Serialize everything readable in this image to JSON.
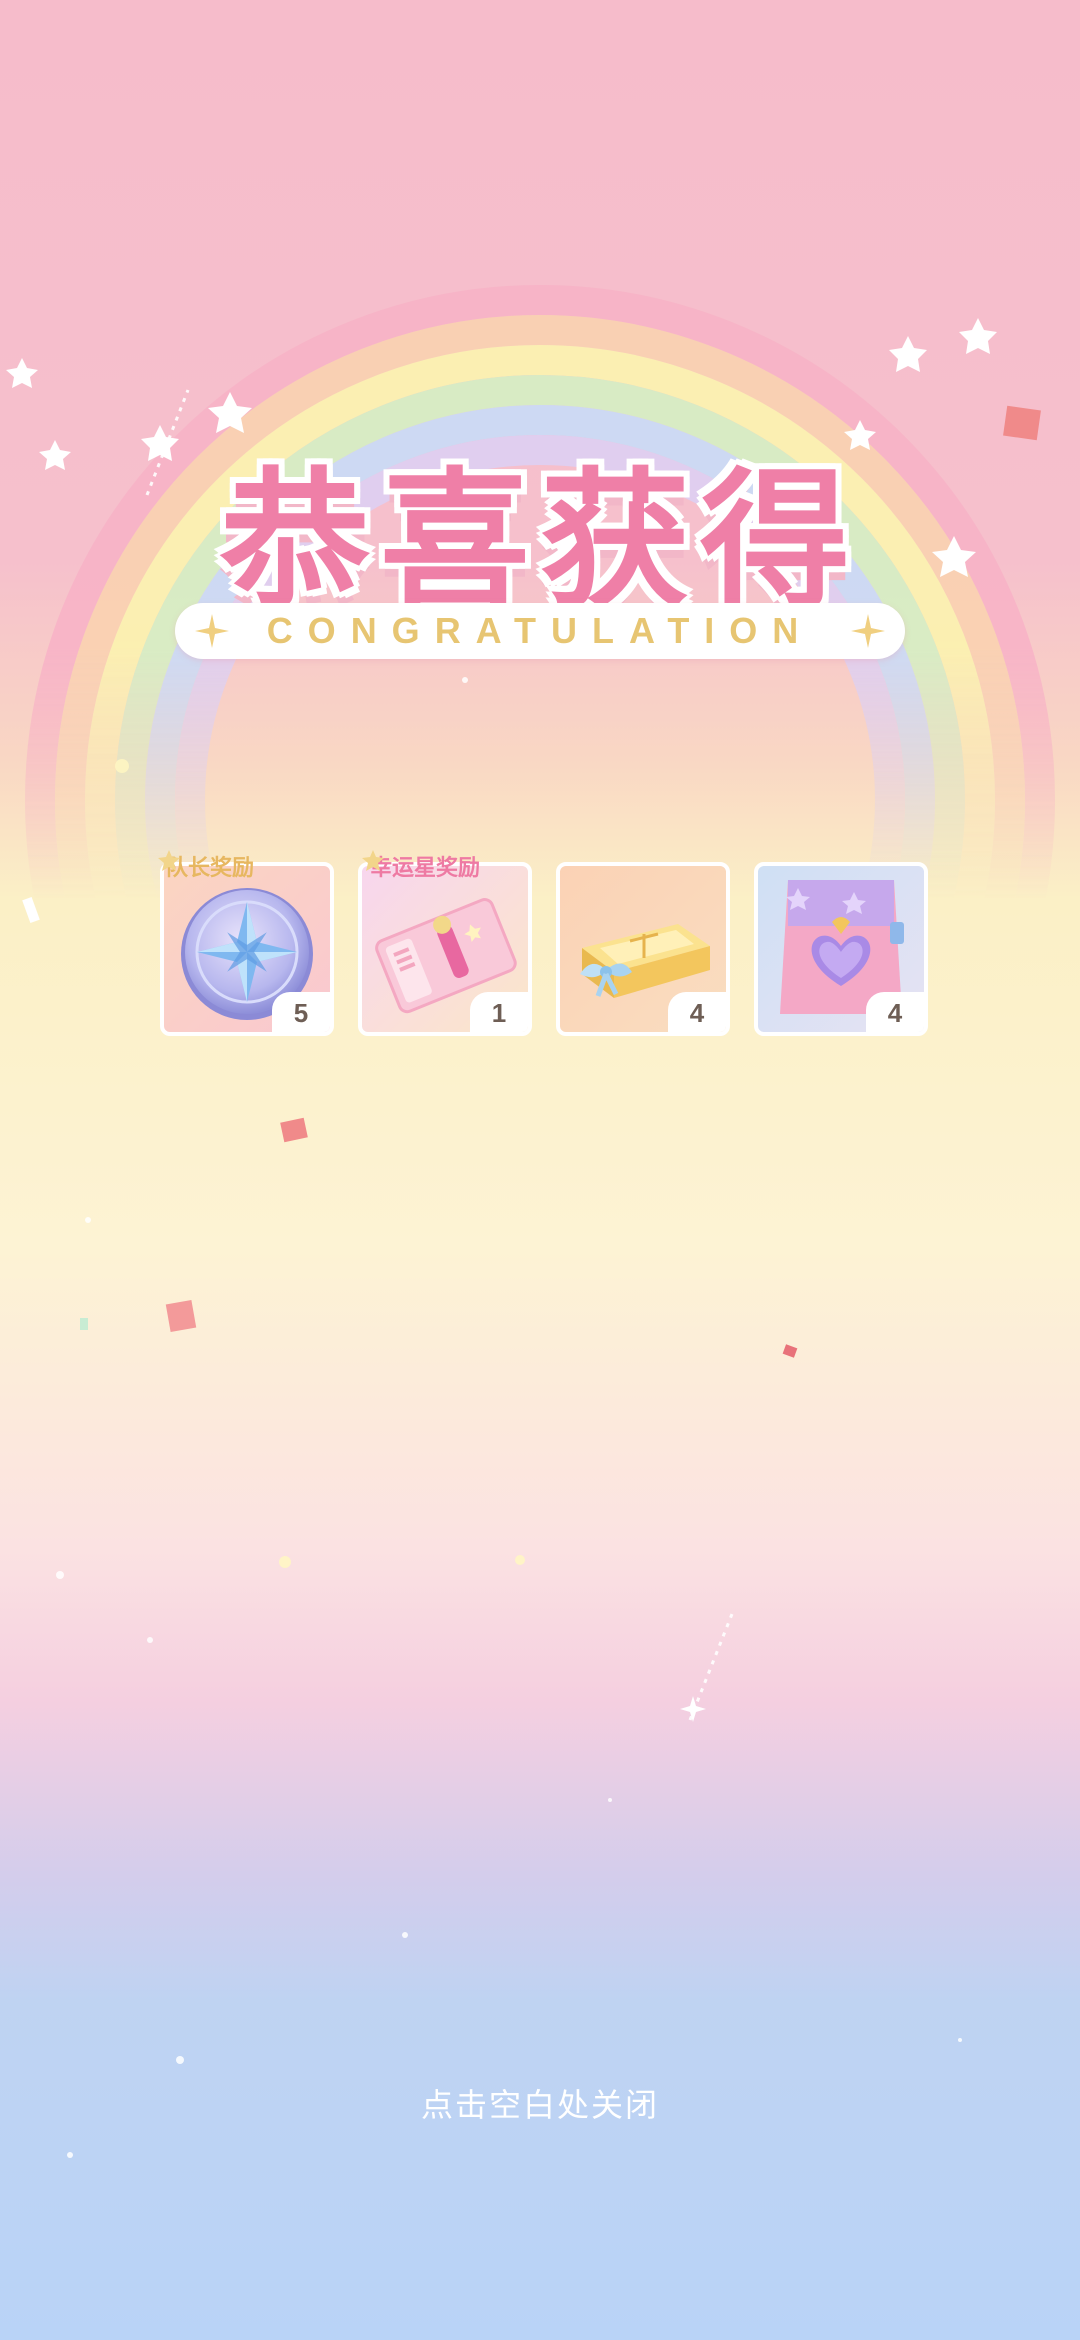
{
  "header": {
    "title_cn": "恭喜获得",
    "title_en": "CONGRATULATION"
  },
  "rewards": [
    {
      "tag": "队长奖励",
      "tag_color": "#e7b760",
      "item": "compass-medal-icon",
      "qty": "5"
    },
    {
      "tag": "幸运星奖励",
      "tag_color": "#ee7aa3",
      "item": "ticket-icon",
      "qty": "1"
    },
    {
      "tag": "",
      "item": "gift-box-icon",
      "qty": "4"
    },
    {
      "tag": "",
      "item": "heart-bag-icon",
      "qty": "4"
    }
  ],
  "footer": {
    "close_hint": "点击空白处关闭"
  },
  "colors": {
    "title_pink": "#ef7fa7",
    "en_gold": "#e7c572",
    "qty_text": "#6e5e55"
  }
}
